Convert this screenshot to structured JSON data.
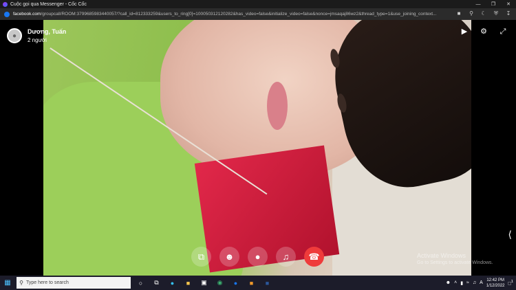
{
  "window": {
    "title": "Cuộc gọi qua Messenger - Cốc Cốc",
    "controls": [
      "minimize-icon",
      "restore-icon",
      "close-icon"
    ]
  },
  "addressbar": {
    "host": "facebook.com",
    "path": "/groupcall/ROOM:3799685983440057/?call_id=812333259&users_to_ring[0]=100050312120282&has_video=false&initialize_video=false&nonce=jmsaqaj86wz2&thread_type=1&use_joining_context..."
  },
  "call": {
    "caller_name": "Dương, Tuấn",
    "participant_count": "2 người",
    "watermark_title": "Activate Windows",
    "watermark_sub": "Go to Settings to activate Windows."
  },
  "taskbar": {
    "search_placeholder": "Type here to search",
    "time": "12:42 PM",
    "date": "1/12/2022",
    "notification_count": "1"
  },
  "colors": {
    "end_call": "#ef3b3b",
    "taskbar": "#1c1c2a",
    "facebook_blue": "#1877f2"
  }
}
